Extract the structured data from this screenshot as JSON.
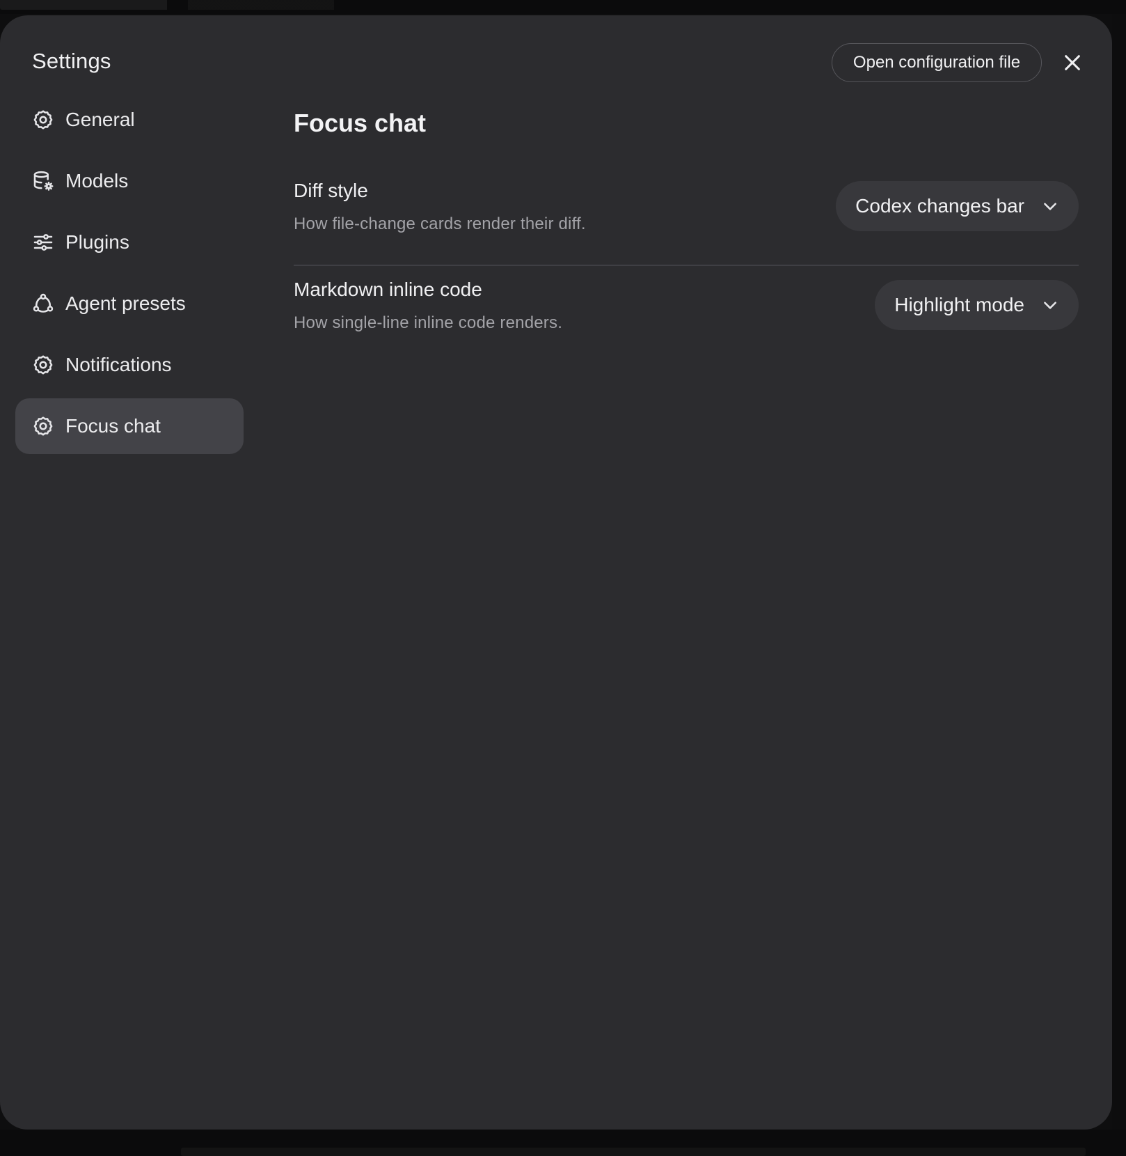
{
  "modal": {
    "title": "Settings",
    "open_config_label": "Open configuration file",
    "close_icon": "close-icon"
  },
  "sidebar": {
    "items": [
      {
        "label": "General",
        "icon": "gear-icon",
        "active": false
      },
      {
        "label": "Models",
        "icon": "database-gear-icon",
        "active": false
      },
      {
        "label": "Plugins",
        "icon": "sliders-icon",
        "active": false
      },
      {
        "label": "Agent presets",
        "icon": "agent-network-icon",
        "active": false
      },
      {
        "label": "Notifications",
        "icon": "gear-icon",
        "active": false
      },
      {
        "label": "Focus chat",
        "icon": "gear-icon",
        "active": true
      }
    ]
  },
  "main": {
    "page_title": "Focus chat",
    "settings": [
      {
        "name": "Diff style",
        "description": "How file-change cards render their diff.",
        "value": "Codex changes bar"
      },
      {
        "name": "Markdown inline code",
        "description": "How single-line inline code renders.",
        "value": "Highlight mode"
      }
    ]
  },
  "colors": {
    "modal_bg": "#2c2c2f",
    "active_nav_bg": "#434348",
    "select_bg": "#38383c",
    "text_primary": "#f1f1f3",
    "text_secondary": "#a3a3a8"
  }
}
